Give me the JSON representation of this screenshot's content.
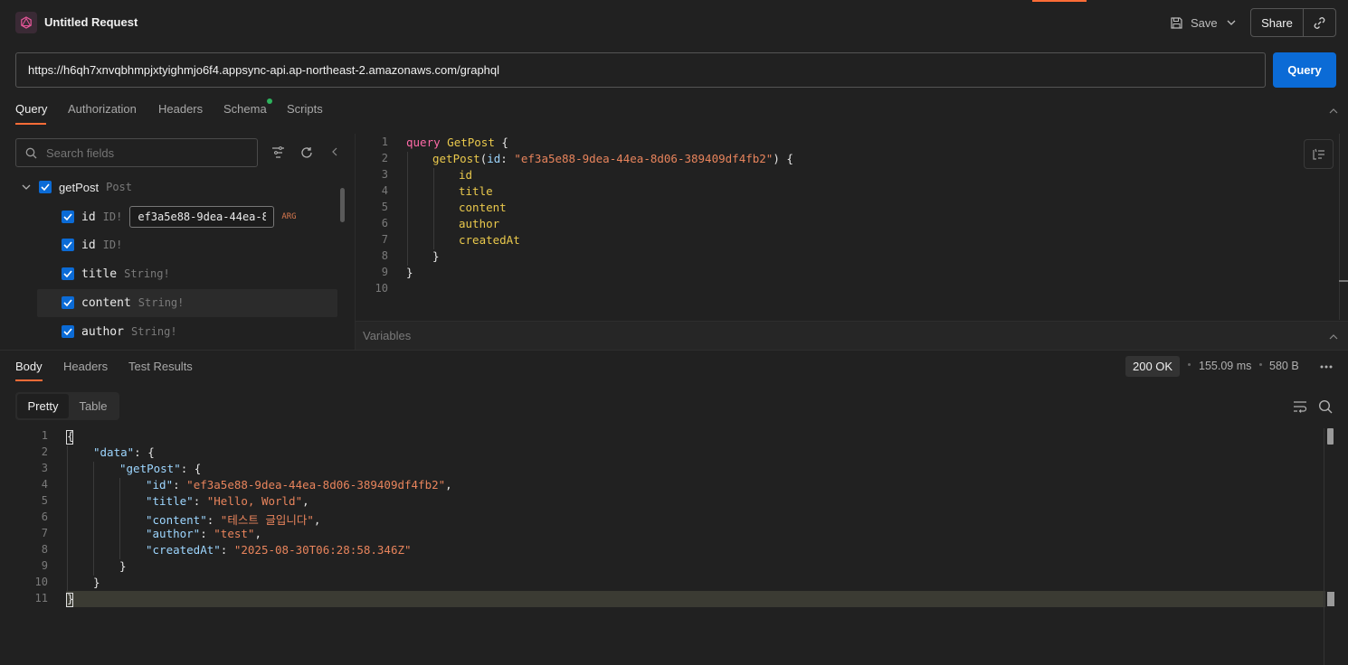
{
  "header": {
    "title": "Untitled Request",
    "save_label": "Save",
    "share_label": "Share"
  },
  "request": {
    "url": "https://h6qh7xnvqbhmpjxtyighmjo6f4.appsync-api.ap-northeast-2.amazonaws.com/graphql",
    "send_label": "Query"
  },
  "tabs": [
    "Query",
    "Authorization",
    "Headers",
    "Schema",
    "Scripts"
  ],
  "explorer": {
    "search_placeholder": "Search fields",
    "root": {
      "name": "getPost",
      "type": "Post"
    },
    "arg": {
      "name": "id",
      "type": "ID!",
      "value": "ef3a5e88-9dea-44ea-8d06-389409df4fb2",
      "tag": "ARG"
    },
    "fields": [
      {
        "name": "id",
        "type": "ID!"
      },
      {
        "name": "title",
        "type": "String!"
      },
      {
        "name": "content",
        "type": "String!"
      },
      {
        "name": "author",
        "type": "String!"
      }
    ]
  },
  "editor": {
    "line_numbers": [
      "1",
      "2",
      "3",
      "4",
      "5",
      "6",
      "7",
      "8",
      "9",
      "10"
    ],
    "kw_query": "query",
    "op_name": "GetPost",
    "brace_open": "{",
    "brace_close": "}",
    "call_name": "getPost",
    "arg_name": "id",
    "arg_value": "\"ef3a5e88-9dea-44ea-8d06-389409df4fb2\"",
    "fields": [
      "id",
      "title",
      "content",
      "author",
      "createdAt"
    ],
    "variables_label": "Variables"
  },
  "response": {
    "tabs": [
      "Body",
      "Headers",
      "Test Results"
    ],
    "status": "200 OK",
    "time": "155.09 ms",
    "size": "580 B",
    "view_modes": [
      "Pretty",
      "Table"
    ],
    "line_numbers": [
      "1",
      "2",
      "3",
      "4",
      "5",
      "6",
      "7",
      "8",
      "9",
      "10",
      "11"
    ],
    "keys": {
      "data": "\"data\"",
      "getPost": "\"getPost\"",
      "id": "\"id\"",
      "title": "\"title\"",
      "content": "\"content\"",
      "author": "\"author\"",
      "createdAt": "\"createdAt\""
    },
    "values": {
      "id": "\"ef3a5e88-9dea-44ea-8d06-389409df4fb2\"",
      "title": "\"Hello, World\"",
      "content": "\"테스트 글입니다\"",
      "author": "\"test\"",
      "createdAt": "\"2025-08-30T06:28:58.346Z\""
    }
  },
  "colors": {
    "accent": "#ff6c37",
    "primary": "#0b6bd6",
    "keyword": "#ff6aa8",
    "function": "#eac94c",
    "string": "#e8845c",
    "key": "#9dd6ff"
  }
}
